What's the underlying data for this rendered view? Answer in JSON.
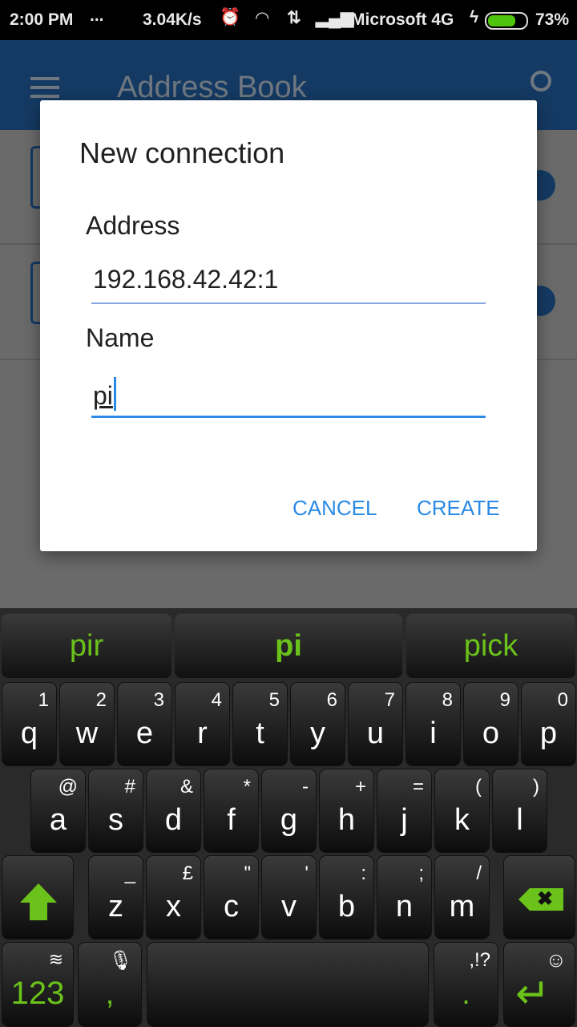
{
  "status": {
    "time": "2:00 PM",
    "dots": "...",
    "speed": "3.04K/s",
    "carrier": "Microsoft 4G",
    "battery": "73%",
    "battery_level": 0.73
  },
  "appbar": {
    "title": "Address Book",
    "menu_icon": "hamburger-icon",
    "search_icon": "search-icon"
  },
  "dialog": {
    "title": "New connection",
    "address_label": "Address",
    "address_value": "192.168.42.42:1",
    "name_label": "Name",
    "name_value": "pi",
    "cancel": "CANCEL",
    "create": "CREATE"
  },
  "keyboard": {
    "suggestions": [
      "pir",
      "pi",
      "pick"
    ],
    "row1": [
      [
        "q",
        "1"
      ],
      [
        "w",
        "2"
      ],
      [
        "e",
        "3"
      ],
      [
        "r",
        "4"
      ],
      [
        "t",
        "5"
      ],
      [
        "y",
        "6"
      ],
      [
        "u",
        "7"
      ],
      [
        "i",
        "8"
      ],
      [
        "o",
        "9"
      ],
      [
        "p",
        "0"
      ]
    ],
    "row2": [
      [
        "a",
        "@"
      ],
      [
        "s",
        "#"
      ],
      [
        "d",
        "&"
      ],
      [
        "f",
        "*"
      ],
      [
        "g",
        "-"
      ],
      [
        "h",
        "+"
      ],
      [
        "j",
        "="
      ],
      [
        "k",
        "("
      ],
      [
        "l",
        ")"
      ]
    ],
    "row3": [
      [
        "z",
        "_"
      ],
      [
        "x",
        "£"
      ],
      [
        "c",
        "\""
      ],
      [
        "v",
        "'"
      ],
      [
        "b",
        ":"
      ],
      [
        "n",
        ";"
      ],
      [
        "m",
        "/"
      ]
    ],
    "numbers": "123",
    "comma": ",",
    "period": ".",
    "period_alt": ",!?",
    "accent": "#6bc21a"
  }
}
